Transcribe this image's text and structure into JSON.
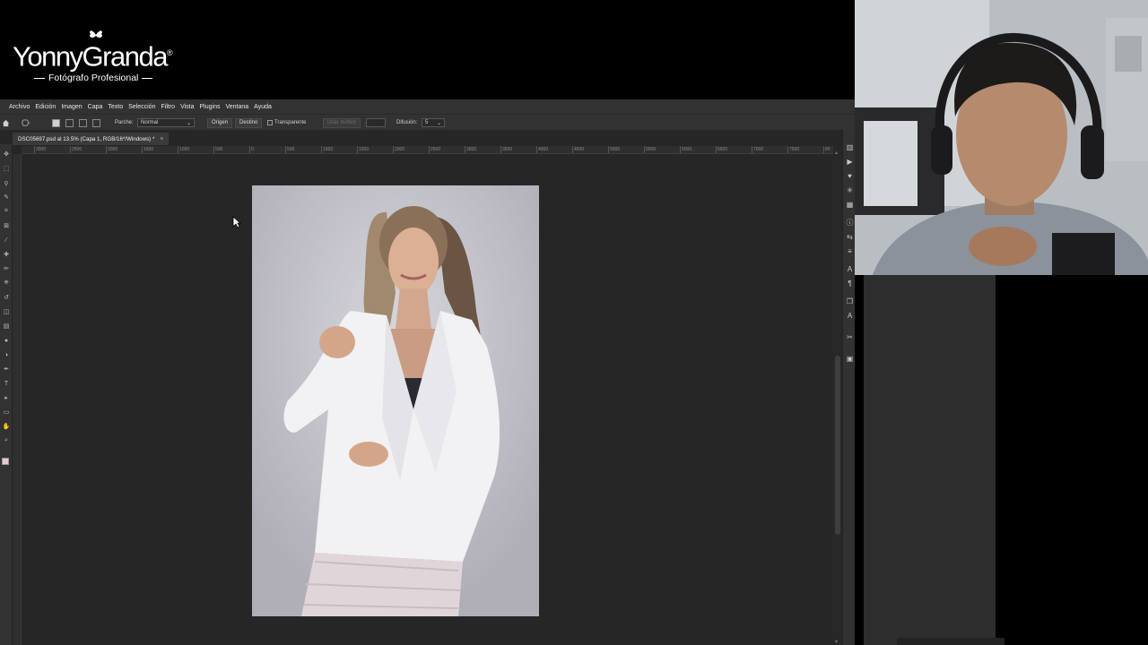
{
  "brand": {
    "name": "YonnyGranda",
    "registered": "®",
    "tagline": "Fotógrafo Profesional"
  },
  "menu": [
    "Archivo",
    "Edición",
    "Imagen",
    "Capa",
    "Texto",
    "Selección",
    "Filtro",
    "Vista",
    "Plugins",
    "Ventana",
    "Ayuda"
  ],
  "options": {
    "patch_label": "Parche:",
    "patch_value": "Normal",
    "origin_label": "Origen",
    "destination_label": "Destino",
    "transparent_label": "Transparente",
    "use_pattern_label": "Usar motivo",
    "diffusion_label": "Difusión:",
    "diffusion_value": "5"
  },
  "document": {
    "tab_title": "DSC05697.psd al 13.5% (Capa 1, RGB/16*/Windows) *",
    "close": "×"
  },
  "ruler": {
    "labels": [
      "3000",
      "2500",
      "2000",
      "1500",
      "1000",
      "500",
      "0",
      "500",
      "1000",
      "1500",
      "2000",
      "2500",
      "3000",
      "3500",
      "4000",
      "4500",
      "5000",
      "5500",
      "6000",
      "6500",
      "7000",
      "7500",
      "80"
    ]
  },
  "icons": {
    "tools": [
      "move-icon",
      "marquee-icon",
      "lasso-icon",
      "quick-select-icon",
      "crop-icon",
      "frame-icon",
      "eyedropper-icon",
      "healing-icon",
      "brush-icon",
      "stamp-icon",
      "history-brush-icon",
      "eraser-icon",
      "gradient-icon",
      "blur-icon",
      "dodge-icon",
      "pen-icon",
      "type-icon",
      "path-select-icon",
      "shape-icon",
      "hand-icon",
      "zoom-icon"
    ],
    "panels": [
      "history-icon",
      "actions-icon",
      "swatches-icon",
      "brushes-icon",
      "adjustments-icon",
      "properties-icon",
      "character-icon",
      "paragraph-icon",
      "layers-icon",
      "glyphs-icon",
      "tools-icon",
      "libraries-icon",
      "adjust-icon",
      "channels-icon"
    ]
  }
}
